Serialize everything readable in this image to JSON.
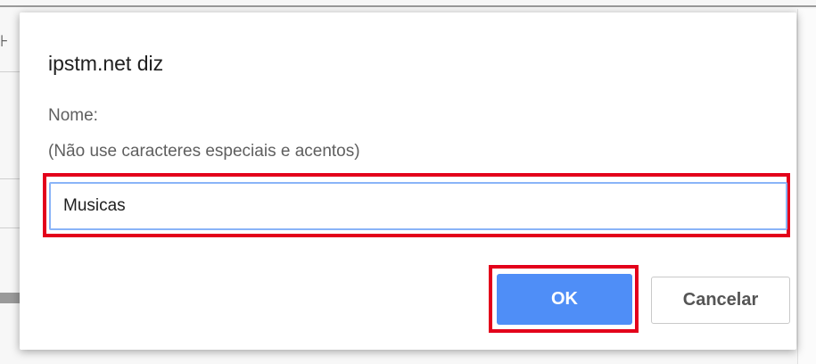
{
  "dialog": {
    "title": "ipstm.net diz",
    "message_line1": "Nome:",
    "message_line2": "(Não use caracteres especiais e acentos)",
    "input_value": "Musicas",
    "ok_label": "OK",
    "cancel_label": "Cancelar"
  },
  "colors": {
    "highlight": "#e3001b",
    "ok_button": "#4f8ef7",
    "input_focus_border": "#8ab4f8"
  }
}
